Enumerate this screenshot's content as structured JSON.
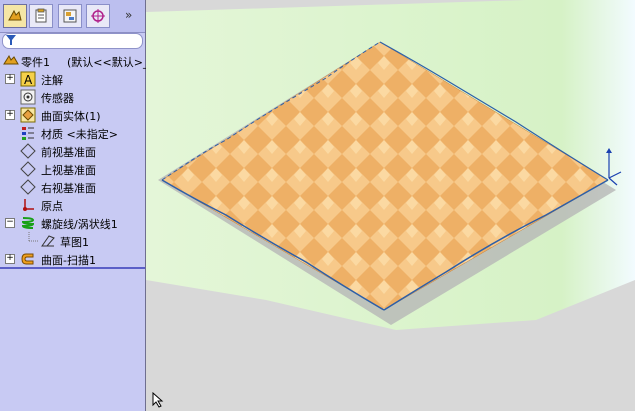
{
  "tabs": [
    {
      "icon": "feature-manager-icon",
      "active": true
    },
    {
      "icon": "property-manager-icon",
      "active": false
    },
    {
      "icon": "configuration-manager-icon",
      "active": false
    },
    {
      "icon": "dimxpert-icon",
      "active": false
    }
  ],
  "more_glyph": "»",
  "tree": {
    "root": {
      "label": "零件1",
      "config": "(默认<<默认>_"
    },
    "items": [
      {
        "label": "注解",
        "icon": "annotation-icon",
        "expander": "+"
      },
      {
        "label": "传感器",
        "icon": "sensor-icon",
        "expander": ""
      },
      {
        "label": "曲面实体(1)",
        "icon": "surface-bodies-icon",
        "expander": "+"
      },
      {
        "label": "材质 <未指定>",
        "icon": "material-icon",
        "expander": ""
      },
      {
        "label": "前视基准面",
        "icon": "plane-icon",
        "expander": ""
      },
      {
        "label": "上视基准面",
        "icon": "plane-icon",
        "expander": ""
      },
      {
        "label": "右视基准面",
        "icon": "plane-icon",
        "expander": ""
      },
      {
        "label": "原点",
        "icon": "origin-icon",
        "expander": ""
      },
      {
        "label": "螺旋线/涡状线1",
        "icon": "helix-icon",
        "expander": "−"
      },
      {
        "label": "草图1",
        "icon": "sketch-icon",
        "expander": "",
        "child": true
      },
      {
        "label": "曲面-扫描1",
        "icon": "surface-sweep-icon",
        "expander": "+"
      }
    ]
  },
  "colors": {
    "panel_bg": "#c8caf3",
    "view_bg": "#d8d8d8",
    "ground_green": "#d8f0c8",
    "surface_light": "#f4c47a",
    "surface_dark": "#e8a060",
    "edge_blue": "#2d5fa8"
  }
}
